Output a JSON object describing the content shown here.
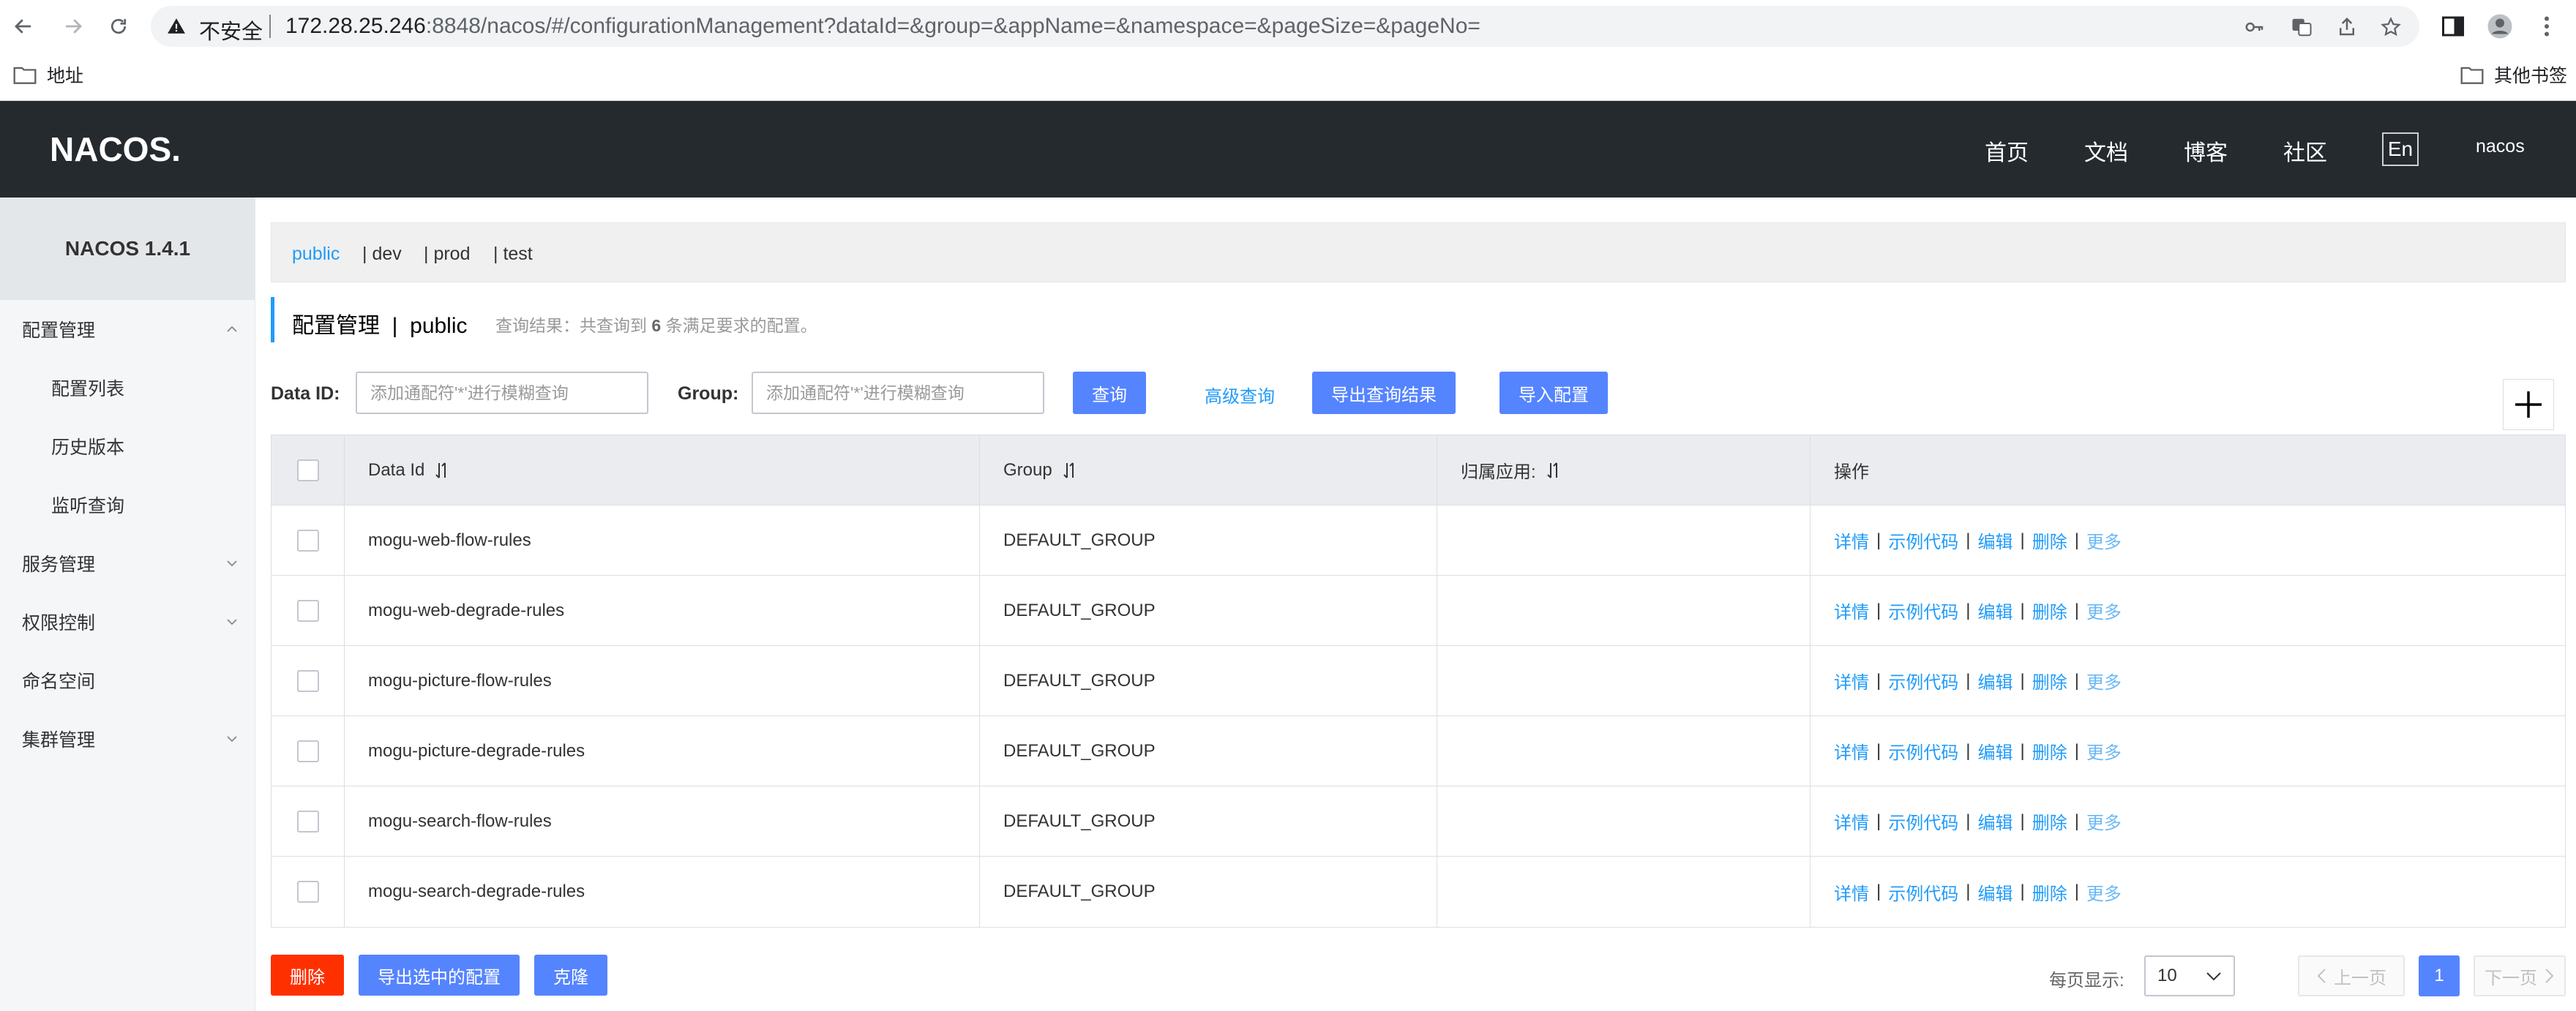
{
  "browser": {
    "insecure_label": "不安全",
    "url_host": "172.28.25.246",
    "url_rest": ":8848/nacos/#/configurationManagement?dataId=&group=&appName=&namespace=&pageSize=&pageNo=",
    "bookmarks": {
      "left": "地址",
      "right": "其他书签"
    }
  },
  "header": {
    "logo": "NACOS.",
    "nav": [
      "首页",
      "文档",
      "博客",
      "社区"
    ],
    "lang": "En",
    "user": "nacos"
  },
  "sidebar": {
    "version": "NACOS 1.4.1",
    "items": [
      {
        "label": "配置管理",
        "level": 1,
        "expanded": true
      },
      {
        "label": "配置列表",
        "level": 2
      },
      {
        "label": "历史版本",
        "level": 2
      },
      {
        "label": "监听查询",
        "level": 2
      },
      {
        "label": "服务管理",
        "level": 1,
        "expanded": false
      },
      {
        "label": "权限控制",
        "level": 1,
        "expanded": false
      },
      {
        "label": "命名空间",
        "level": 1
      },
      {
        "label": "集群管理",
        "level": 1,
        "expanded": false
      }
    ]
  },
  "namespaces": {
    "active": "public",
    "others": [
      "| dev",
      "| prod",
      "| test"
    ]
  },
  "page": {
    "title": "配置管理  |  public",
    "result_prefix": "查询结果：共查询到",
    "result_count": "6",
    "result_suffix": "条满足要求的配置。"
  },
  "filters": {
    "data_id_label": "Data ID:",
    "data_id_placeholder": "添加通配符'*'进行模糊查询",
    "group_label": "Group:",
    "group_placeholder": "添加通配符'*'进行模糊查询",
    "query_btn": "查询",
    "advanced_link": "高级查询",
    "export_btn": "导出查询结果",
    "import_btn": "导入配置"
  },
  "table": {
    "headers": {
      "data_id": "Data Id",
      "group": "Group",
      "app": "归属应用:",
      "ops": "操作"
    },
    "rows": [
      {
        "data_id": "mogu-web-flow-rules",
        "group": "DEFAULT_GROUP",
        "app": ""
      },
      {
        "data_id": "mogu-web-degrade-rules",
        "group": "DEFAULT_GROUP",
        "app": ""
      },
      {
        "data_id": "mogu-picture-flow-rules",
        "group": "DEFAULT_GROUP",
        "app": ""
      },
      {
        "data_id": "mogu-picture-degrade-rules",
        "group": "DEFAULT_GROUP",
        "app": ""
      },
      {
        "data_id": "mogu-search-flow-rules",
        "group": "DEFAULT_GROUP",
        "app": ""
      },
      {
        "data_id": "mogu-search-degrade-rules",
        "group": "DEFAULT_GROUP",
        "app": ""
      }
    ],
    "ops": {
      "detail": "详情",
      "sample": "示例代码",
      "edit": "编辑",
      "delete": "删除",
      "more": "更多"
    }
  },
  "footer": {
    "delete_btn": "删除",
    "export_selected_btn": "导出选中的配置",
    "clone_btn": "克隆",
    "page_size_label": "每页显示:",
    "page_size": "10",
    "prev": "上一页",
    "current_page": "1",
    "next": "下一页"
  },
  "colors": {
    "header_bg": "#252a2f",
    "accent": "#209bfa",
    "primary_btn": "#5584ff",
    "danger_btn": "#ff3000"
  }
}
